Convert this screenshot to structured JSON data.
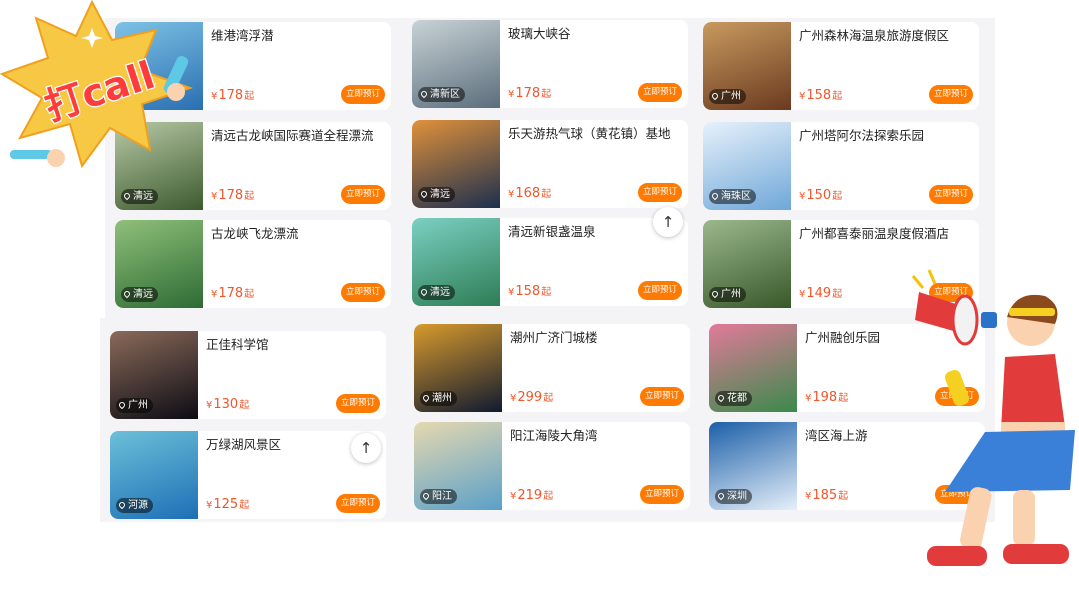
{
  "book_label": "立即预订",
  "currency": "¥",
  "price_unit": "起",
  "sticker_text": "打call",
  "cards": [
    {
      "title": "维港湾浮潜",
      "price": "178",
      "location": ""
    },
    {
      "title": "清远古龙峡国际赛道全程漂流",
      "price": "178",
      "location": "清远"
    },
    {
      "title": "古龙峡飞龙漂流",
      "price": "178",
      "location": "清远"
    },
    {
      "title": "玻璃大峡谷",
      "price": "178",
      "location": "清新区"
    },
    {
      "title": "乐天游热气球（黄花镇）基地",
      "price": "168",
      "location": "清远"
    },
    {
      "title": "清远新银盏温泉",
      "price": "158",
      "location": "清远"
    },
    {
      "title": "广州森林海温泉旅游度假区",
      "price": "158",
      "location": "广州"
    },
    {
      "title": "广州塔阿尔法探索乐园",
      "price": "150",
      "location": "海珠区"
    },
    {
      "title": "广州都喜泰丽温泉度假酒店",
      "price": "149",
      "location": "广州"
    },
    {
      "title": "正佳科学馆",
      "price": "130",
      "location": "广州"
    },
    {
      "title": "万绿湖风景区",
      "price": "125",
      "location": "河源"
    },
    {
      "title": "潮州广济门城楼",
      "price": "299",
      "location": "潮州"
    },
    {
      "title": "阳江海陵大角湾",
      "price": "219",
      "location": "阳江"
    },
    {
      "title": "广州融创乐园",
      "price": "198",
      "location": "花都"
    },
    {
      "title": "湾区海上游",
      "price": "185",
      "location": "深圳"
    }
  ],
  "thumb_colors": [
    [
      "#2a6fb0",
      "#7ec2e6"
    ],
    [
      "#3d5a2e",
      "#b7c9a6"
    ],
    [
      "#2e6b34",
      "#8fc07a"
    ],
    [
      "#5b6e7c",
      "#c9d3d6"
    ],
    [
      "#1c2f4e",
      "#e0913a"
    ],
    [
      "#2e7d55",
      "#7ad0c2"
    ],
    [
      "#6b3a20",
      "#c89a5f"
    ],
    [
      "#6fa7d8",
      "#e7f1fb"
    ],
    [
      "#38582a",
      "#9ab88c"
    ],
    [
      "#0c0c14",
      "#8b6a5a"
    ],
    [
      "#1d6fb6",
      "#6cc0d8"
    ],
    [
      "#101a30",
      "#d89a2c"
    ],
    [
      "#5aa0c8",
      "#e6d8b0"
    ],
    [
      "#3a8a4a",
      "#e27a9a"
    ],
    [
      "#e6f0fa",
      "#1c5fa8"
    ]
  ],
  "accent_color": "#ff7a00",
  "price_color": "#f0562b"
}
